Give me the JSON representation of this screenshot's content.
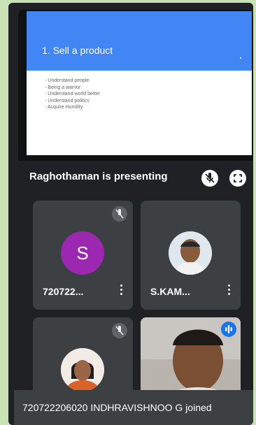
{
  "presentation": {
    "slide_title": "1. Sell a product",
    "bullets": [
      "Understand people",
      "Being a warrior",
      "Understand world better",
      "Understand politics",
      "Acquire Humility"
    ],
    "presenter_label": "Raghothaman is presenting"
  },
  "participants": [
    {
      "name": "720722...",
      "avatar_letter": "S",
      "muted": true
    },
    {
      "name": "S.KAM...",
      "muted": false
    },
    {
      "name": "",
      "muted": true
    },
    {
      "name": "",
      "speaking": true
    }
  ],
  "toast": "720722206020 INDHRAVISHNOO G joined",
  "colors": {
    "meet_bg": "#202124",
    "tile_bg": "#3c4043",
    "slide_header": "#4285f4",
    "avatar_purple": "#9c27b0"
  },
  "icons": [
    "mic-off-icon",
    "fullscreen-icon",
    "more-vert-icon",
    "speaking-icon"
  ]
}
